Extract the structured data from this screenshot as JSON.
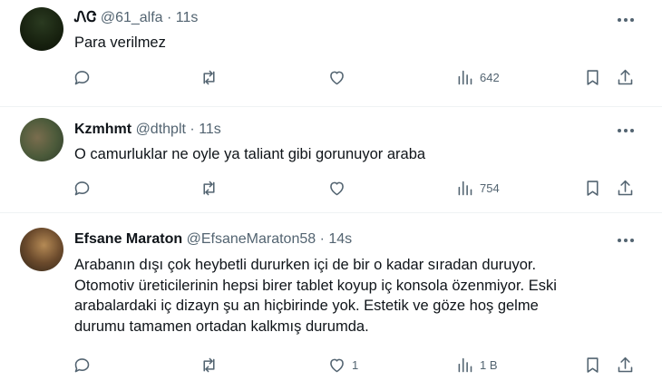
{
  "tweets": [
    {
      "name": "ᏁᏣ",
      "handle": "@61_alfa",
      "time": "11s",
      "lines": [
        "Para verilmez"
      ],
      "likes": "",
      "views": "642"
    },
    {
      "name": "Kzmhmt",
      "handle": "@dthplt",
      "time": "11s",
      "lines": [
        "O camurluklar ne oyle ya taliant gibi gorunuyor araba"
      ],
      "likes": "",
      "views": "754"
    },
    {
      "name": "Efsane Maraton",
      "handle": "@EfsaneMaraton58",
      "time": "14s",
      "lines": [
        "Arabanın dışı çok heybetli dururken içi de bir o kadar sıradan duruyor.",
        "Otomotiv üreticilerinin hepsi birer tablet koyup iç konsola özenmiyor. Eski",
        "arabalardaki iç dizayn şu an hiçbirinde yok. Estetik ve göze hoş gelme",
        "durumu tamamen ortadan kalkmış durumda."
      ],
      "likes": "1",
      "views": "1 B"
    }
  ],
  "separator": "·"
}
